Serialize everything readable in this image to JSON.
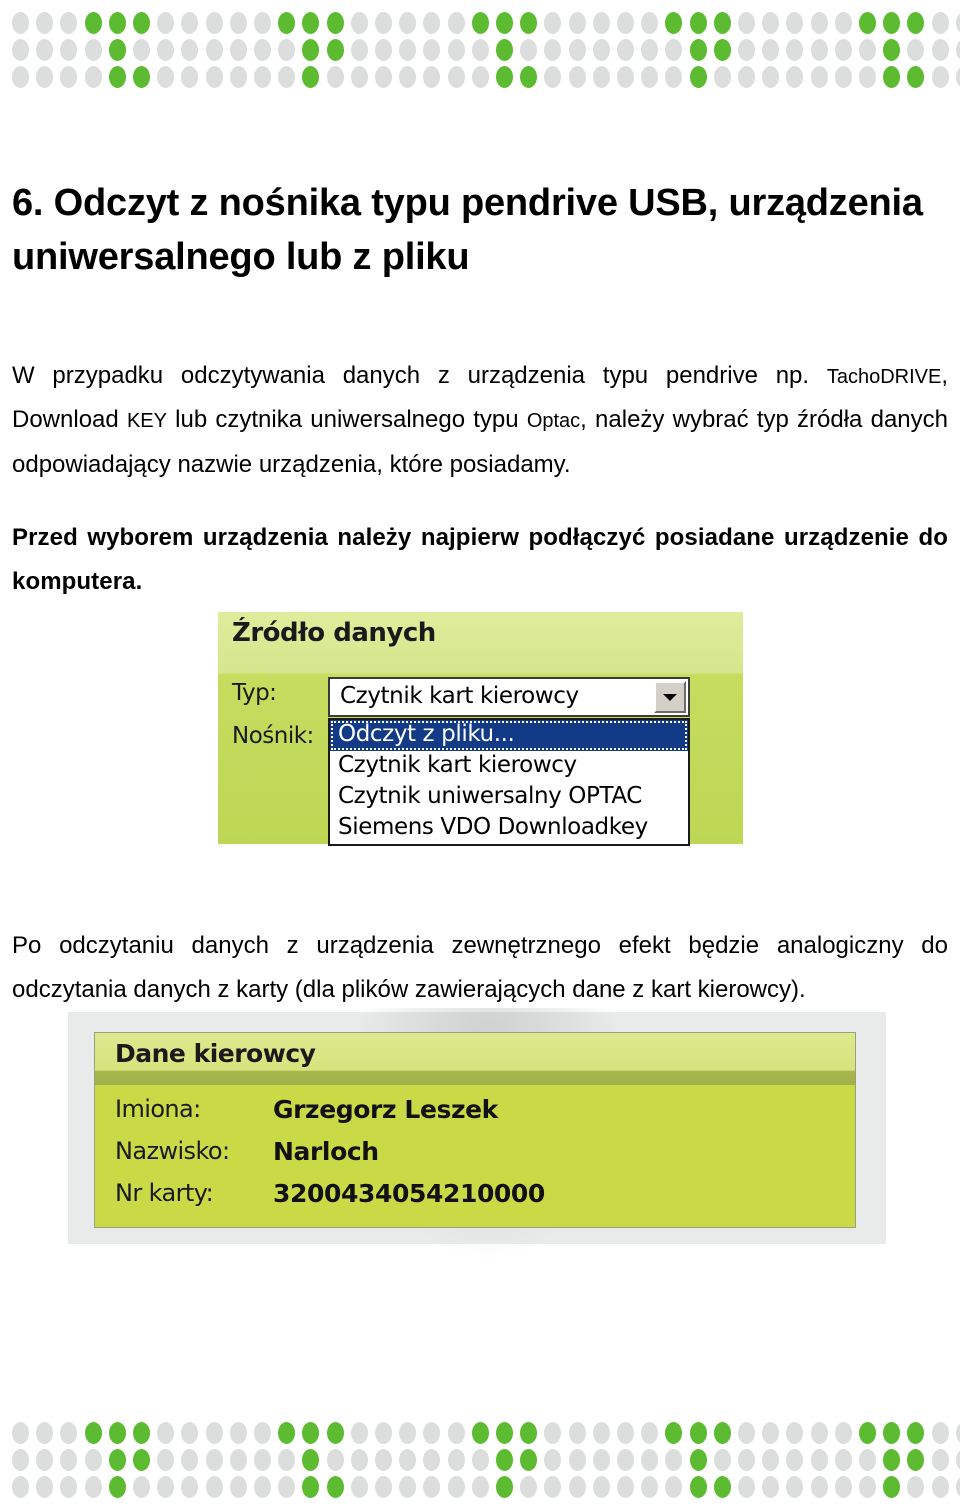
{
  "document": {
    "title": "6. Odczyt z nośnika typu pendrive USB, urządzenia uniwersalnego lub z pliku",
    "paragraph_1_a": "W przypadku odczytywania danych z urządzenia typu pendrive np. ",
    "paragraph_1_b": "TachoDRIVE",
    "paragraph_1_c": ", Download ",
    "paragraph_1_d": "KEY",
    "paragraph_1_e": " lub czytnika uniwersalnego typu ",
    "paragraph_1_f": "Optac",
    "paragraph_1_g": ", należy wybrać typ źródła danych odpowiadający nazwie urządzenia, które posiadamy.",
    "paragraph_2": "Przed wyborem urządzenia należy najpierw podłączyć posiadane urządzenie do komputera.",
    "paragraph_3": "Po odczytaniu danych z urządzenia zewnętrznego efekt będzie analogiczny do odczytania danych z karty (dla plików zawierających dane z kart kierowcy)."
  },
  "decor": {
    "dot_color_on": "#5cbb30",
    "dot_color_off": "#dcdddd"
  },
  "source_dialog": {
    "title": "Źródło danych",
    "label_typ": "Typ:",
    "label_nosnik": "Nośnik:",
    "combo_value": "Czytnik kart kierowcy",
    "arrow_icon": "chevron-down-icon",
    "options": [
      {
        "label": "Odczyt z pliku...",
        "selected": true
      },
      {
        "label": "Czytnik kart kierowcy",
        "selected": false
      },
      {
        "label": "Czytnik uniwersalny OPTAC",
        "selected": false
      },
      {
        "label": "Siemens VDO Downloadkey",
        "selected": false
      }
    ],
    "highlight_color": "#123a87",
    "panel_color": "#c6dc5f"
  },
  "driver_panel": {
    "title": "Dane kierowcy",
    "rows": [
      {
        "key": "Imiona:",
        "value": "Grzegorz Leszek"
      },
      {
        "key": "Nazwisko:",
        "value": "Narloch"
      },
      {
        "key": "Nr karty:",
        "value": "3200434054210000"
      }
    ],
    "header_color": "#a8b84e",
    "body_color": "#cada46"
  }
}
